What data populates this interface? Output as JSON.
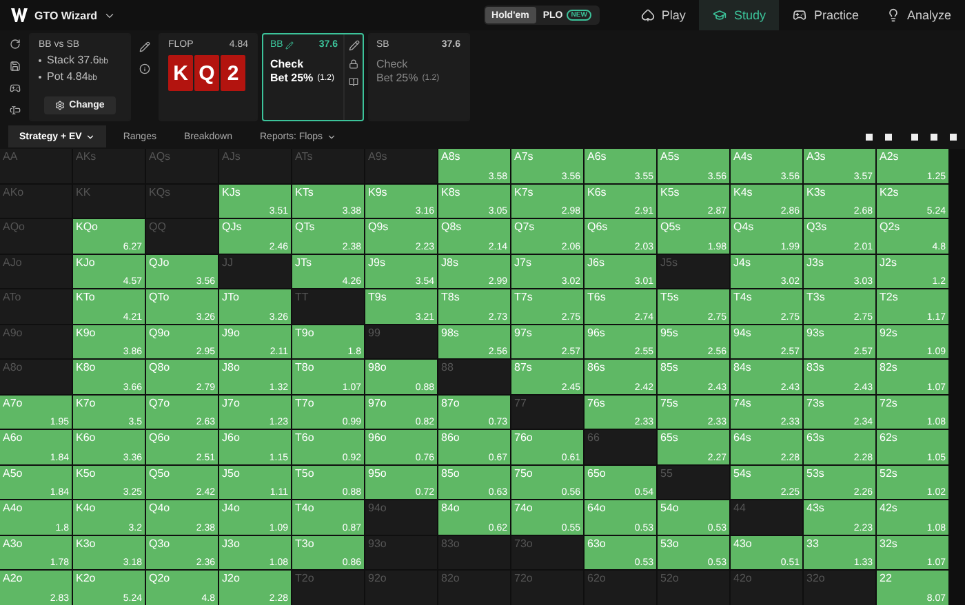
{
  "app": {
    "title": "GTO Wizard"
  },
  "game_toggle": [
    {
      "label": "Hold'em",
      "selected": true
    },
    {
      "label": "PLO",
      "selected": false,
      "badge": "NEW"
    }
  ],
  "nav": [
    {
      "label": "Play",
      "selected": false
    },
    {
      "label": "Study",
      "selected": true
    },
    {
      "label": "Practice",
      "selected": false
    },
    {
      "label": "Analyze",
      "selected": false
    }
  ],
  "scenario": {
    "title": "BB vs SB",
    "lines": [
      {
        "label": "Stack 37.6",
        "unit": "bb"
      },
      {
        "label": "Pot 4.84",
        "unit": "bb"
      }
    ],
    "button": "Change"
  },
  "flop": {
    "label": "FLOP",
    "pot": "4.84",
    "cards": [
      "K",
      "Q",
      "2"
    ]
  },
  "players": [
    {
      "name": "BB",
      "stack": "37.6",
      "selected": true,
      "actions": [
        "Check",
        "Bet 25%"
      ],
      "size": "(1.2)"
    },
    {
      "name": "SB",
      "stack": "37.6",
      "selected": false,
      "actions": [
        "Check",
        "Bet 25%"
      ],
      "size": "(1.2)"
    }
  ],
  "tabs": [
    {
      "label": "Strategy + EV",
      "selected": true,
      "dropdown": true
    },
    {
      "label": "Ranges",
      "selected": false,
      "dropdown": false
    },
    {
      "label": "Breakdown",
      "selected": false,
      "dropdown": false
    },
    {
      "label": "Reports: Flops",
      "selected": false,
      "dropdown": true
    }
  ],
  "grid": [
    [
      {
        "hand": "AA",
        "active": false
      },
      {
        "hand": "AKs",
        "active": false
      },
      {
        "hand": "AQs",
        "active": false
      },
      {
        "hand": "AJs",
        "active": false
      },
      {
        "hand": "ATs",
        "active": false
      },
      {
        "hand": "A9s",
        "active": false
      },
      {
        "hand": "A8s",
        "active": true,
        "ev": "3.58"
      },
      {
        "hand": "A7s",
        "active": true,
        "ev": "3.56"
      },
      {
        "hand": "A6s",
        "active": true,
        "ev": "3.55"
      },
      {
        "hand": "A5s",
        "active": true,
        "ev": "3.56"
      },
      {
        "hand": "A4s",
        "active": true,
        "ev": "3.56"
      },
      {
        "hand": "A3s",
        "active": true,
        "ev": "3.57"
      },
      {
        "hand": "A2s",
        "active": true,
        "ev": "1.25"
      }
    ],
    [
      {
        "hand": "AKo",
        "active": false
      },
      {
        "hand": "KK",
        "active": false
      },
      {
        "hand": "KQs",
        "active": false
      },
      {
        "hand": "KJs",
        "active": true,
        "ev": "3.51"
      },
      {
        "hand": "KTs",
        "active": true,
        "ev": "3.38"
      },
      {
        "hand": "K9s",
        "active": true,
        "ev": "3.16"
      },
      {
        "hand": "K8s",
        "active": true,
        "ev": "3.05"
      },
      {
        "hand": "K7s",
        "active": true,
        "ev": "2.98"
      },
      {
        "hand": "K6s",
        "active": true,
        "ev": "2.91"
      },
      {
        "hand": "K5s",
        "active": true,
        "ev": "2.87"
      },
      {
        "hand": "K4s",
        "active": true,
        "ev": "2.86"
      },
      {
        "hand": "K3s",
        "active": true,
        "ev": "2.68"
      },
      {
        "hand": "K2s",
        "active": true,
        "ev": "5.24"
      }
    ],
    [
      {
        "hand": "AQo",
        "active": false
      },
      {
        "hand": "KQo",
        "active": true,
        "ev": "6.27"
      },
      {
        "hand": "QQ",
        "active": false
      },
      {
        "hand": "QJs",
        "active": true,
        "ev": "2.46"
      },
      {
        "hand": "QTs",
        "active": true,
        "ev": "2.38"
      },
      {
        "hand": "Q9s",
        "active": true,
        "ev": "2.23"
      },
      {
        "hand": "Q8s",
        "active": true,
        "ev": "2.14"
      },
      {
        "hand": "Q7s",
        "active": true,
        "ev": "2.06"
      },
      {
        "hand": "Q6s",
        "active": true,
        "ev": "2.03"
      },
      {
        "hand": "Q5s",
        "active": true,
        "ev": "1.98"
      },
      {
        "hand": "Q4s",
        "active": true,
        "ev": "1.99"
      },
      {
        "hand": "Q3s",
        "active": true,
        "ev": "2.01"
      },
      {
        "hand": "Q2s",
        "active": true,
        "ev": "4.8"
      }
    ],
    [
      {
        "hand": "AJo",
        "active": false
      },
      {
        "hand": "KJo",
        "active": true,
        "ev": "4.57"
      },
      {
        "hand": "QJo",
        "active": true,
        "ev": "3.56"
      },
      {
        "hand": "JJ",
        "active": false
      },
      {
        "hand": "JTs",
        "active": true,
        "ev": "4.26"
      },
      {
        "hand": "J9s",
        "active": true,
        "ev": "3.54"
      },
      {
        "hand": "J8s",
        "active": true,
        "ev": "2.99"
      },
      {
        "hand": "J7s",
        "active": true,
        "ev": "3.02"
      },
      {
        "hand": "J6s",
        "active": true,
        "ev": "3.01"
      },
      {
        "hand": "J5s",
        "active": false
      },
      {
        "hand": "J4s",
        "active": true,
        "ev": "3.02"
      },
      {
        "hand": "J3s",
        "active": true,
        "ev": "3.03"
      },
      {
        "hand": "J2s",
        "active": true,
        "ev": "1.2"
      }
    ],
    [
      {
        "hand": "ATo",
        "active": false
      },
      {
        "hand": "KTo",
        "active": true,
        "ev": "4.21"
      },
      {
        "hand": "QTo",
        "active": true,
        "ev": "3.26"
      },
      {
        "hand": "JTo",
        "active": true,
        "ev": "3.26"
      },
      {
        "hand": "TT",
        "active": false
      },
      {
        "hand": "T9s",
        "active": true,
        "ev": "3.21"
      },
      {
        "hand": "T8s",
        "active": true,
        "ev": "2.73"
      },
      {
        "hand": "T7s",
        "active": true,
        "ev": "2.75"
      },
      {
        "hand": "T6s",
        "active": true,
        "ev": "2.74"
      },
      {
        "hand": "T5s",
        "active": true,
        "ev": "2.75"
      },
      {
        "hand": "T4s",
        "active": true,
        "ev": "2.75"
      },
      {
        "hand": "T3s",
        "active": true,
        "ev": "2.75"
      },
      {
        "hand": "T2s",
        "active": true,
        "ev": "1.17"
      }
    ],
    [
      {
        "hand": "A9o",
        "active": false
      },
      {
        "hand": "K9o",
        "active": true,
        "ev": "3.86"
      },
      {
        "hand": "Q9o",
        "active": true,
        "ev": "2.95"
      },
      {
        "hand": "J9o",
        "active": true,
        "ev": "2.11"
      },
      {
        "hand": "T9o",
        "active": true,
        "ev": "1.8"
      },
      {
        "hand": "99",
        "active": false
      },
      {
        "hand": "98s",
        "active": true,
        "ev": "2.56"
      },
      {
        "hand": "97s",
        "active": true,
        "ev": "2.57"
      },
      {
        "hand": "96s",
        "active": true,
        "ev": "2.55"
      },
      {
        "hand": "95s",
        "active": true,
        "ev": "2.56"
      },
      {
        "hand": "94s",
        "active": true,
        "ev": "2.57"
      },
      {
        "hand": "93s",
        "active": true,
        "ev": "2.57"
      },
      {
        "hand": "92s",
        "active": true,
        "ev": "1.09"
      }
    ],
    [
      {
        "hand": "A8o",
        "active": false
      },
      {
        "hand": "K8o",
        "active": true,
        "ev": "3.66"
      },
      {
        "hand": "Q8o",
        "active": true,
        "ev": "2.79"
      },
      {
        "hand": "J8o",
        "active": true,
        "ev": "1.32"
      },
      {
        "hand": "T8o",
        "active": true,
        "ev": "1.07"
      },
      {
        "hand": "98o",
        "active": true,
        "ev": "0.88"
      },
      {
        "hand": "88",
        "active": false
      },
      {
        "hand": "87s",
        "active": true,
        "ev": "2.45"
      },
      {
        "hand": "86s",
        "active": true,
        "ev": "2.42"
      },
      {
        "hand": "85s",
        "active": true,
        "ev": "2.43"
      },
      {
        "hand": "84s",
        "active": true,
        "ev": "2.43"
      },
      {
        "hand": "83s",
        "active": true,
        "ev": "2.43"
      },
      {
        "hand": "82s",
        "active": true,
        "ev": "1.07"
      }
    ],
    [
      {
        "hand": "A7o",
        "active": true,
        "ev": "1.95"
      },
      {
        "hand": "K7o",
        "active": true,
        "ev": "3.5"
      },
      {
        "hand": "Q7o",
        "active": true,
        "ev": "2.63"
      },
      {
        "hand": "J7o",
        "active": true,
        "ev": "1.23"
      },
      {
        "hand": "T7o",
        "active": true,
        "ev": "0.99"
      },
      {
        "hand": "97o",
        "active": true,
        "ev": "0.82"
      },
      {
        "hand": "87o",
        "active": true,
        "ev": "0.73"
      },
      {
        "hand": "77",
        "active": false
      },
      {
        "hand": "76s",
        "active": true,
        "ev": "2.33"
      },
      {
        "hand": "75s",
        "active": true,
        "ev": "2.33"
      },
      {
        "hand": "74s",
        "active": true,
        "ev": "2.33"
      },
      {
        "hand": "73s",
        "active": true,
        "ev": "2.34"
      },
      {
        "hand": "72s",
        "active": true,
        "ev": "1.08"
      }
    ],
    [
      {
        "hand": "A6o",
        "active": true,
        "ev": "1.84"
      },
      {
        "hand": "K6o",
        "active": true,
        "ev": "3.36"
      },
      {
        "hand": "Q6o",
        "active": true,
        "ev": "2.51"
      },
      {
        "hand": "J6o",
        "active": true,
        "ev": "1.15"
      },
      {
        "hand": "T6o",
        "active": true,
        "ev": "0.92"
      },
      {
        "hand": "96o",
        "active": true,
        "ev": "0.76"
      },
      {
        "hand": "86o",
        "active": true,
        "ev": "0.67"
      },
      {
        "hand": "76o",
        "active": true,
        "ev": "0.61"
      },
      {
        "hand": "66",
        "active": false
      },
      {
        "hand": "65s",
        "active": true,
        "ev": "2.27"
      },
      {
        "hand": "64s",
        "active": true,
        "ev": "2.28"
      },
      {
        "hand": "63s",
        "active": true,
        "ev": "2.28"
      },
      {
        "hand": "62s",
        "active": true,
        "ev": "1.05"
      }
    ],
    [
      {
        "hand": "A5o",
        "active": true,
        "ev": "1.84"
      },
      {
        "hand": "K5o",
        "active": true,
        "ev": "3.25"
      },
      {
        "hand": "Q5o",
        "active": true,
        "ev": "2.42"
      },
      {
        "hand": "J5o",
        "active": true,
        "ev": "1.11"
      },
      {
        "hand": "T5o",
        "active": true,
        "ev": "0.88"
      },
      {
        "hand": "95o",
        "active": true,
        "ev": "0.72"
      },
      {
        "hand": "85o",
        "active": true,
        "ev": "0.63"
      },
      {
        "hand": "75o",
        "active": true,
        "ev": "0.56"
      },
      {
        "hand": "65o",
        "active": true,
        "ev": "0.54"
      },
      {
        "hand": "55",
        "active": false
      },
      {
        "hand": "54s",
        "active": true,
        "ev": "2.25"
      },
      {
        "hand": "53s",
        "active": true,
        "ev": "2.26"
      },
      {
        "hand": "52s",
        "active": true,
        "ev": "1.02"
      }
    ],
    [
      {
        "hand": "A4o",
        "active": true,
        "ev": "1.8"
      },
      {
        "hand": "K4o",
        "active": true,
        "ev": "3.2"
      },
      {
        "hand": "Q4o",
        "active": true,
        "ev": "2.38"
      },
      {
        "hand": "J4o",
        "active": true,
        "ev": "1.09"
      },
      {
        "hand": "T4o",
        "active": true,
        "ev": "0.87"
      },
      {
        "hand": "94o",
        "active": false
      },
      {
        "hand": "84o",
        "active": true,
        "ev": "0.62"
      },
      {
        "hand": "74o",
        "active": true,
        "ev": "0.55"
      },
      {
        "hand": "64o",
        "active": true,
        "ev": "0.53"
      },
      {
        "hand": "54o",
        "active": true,
        "ev": "0.53"
      },
      {
        "hand": "44",
        "active": false
      },
      {
        "hand": "43s",
        "active": true,
        "ev": "2.23"
      },
      {
        "hand": "42s",
        "active": true,
        "ev": "1.08"
      }
    ],
    [
      {
        "hand": "A3o",
        "active": true,
        "ev": "1.78"
      },
      {
        "hand": "K3o",
        "active": true,
        "ev": "3.18"
      },
      {
        "hand": "Q3o",
        "active": true,
        "ev": "2.36"
      },
      {
        "hand": "J3o",
        "active": true,
        "ev": "1.08"
      },
      {
        "hand": "T3o",
        "active": true,
        "ev": "0.86"
      },
      {
        "hand": "93o",
        "active": false
      },
      {
        "hand": "83o",
        "active": false
      },
      {
        "hand": "73o",
        "active": false
      },
      {
        "hand": "63o",
        "active": true,
        "ev": "0.53"
      },
      {
        "hand": "53o",
        "active": true,
        "ev": "0.53"
      },
      {
        "hand": "43o",
        "active": true,
        "ev": "0.51"
      },
      {
        "hand": "33",
        "active": true,
        "ev": "1.33"
      },
      {
        "hand": "32s",
        "active": true,
        "ev": "1.07"
      }
    ],
    [
      {
        "hand": "A2o",
        "active": true,
        "ev": "2.83"
      },
      {
        "hand": "K2o",
        "active": true,
        "ev": "5.24"
      },
      {
        "hand": "Q2o",
        "active": true,
        "ev": "4.8"
      },
      {
        "hand": "J2o",
        "active": true,
        "ev": "2.28"
      },
      {
        "hand": "T2o",
        "active": false
      },
      {
        "hand": "92o",
        "active": false
      },
      {
        "hand": "82o",
        "active": false
      },
      {
        "hand": "72o",
        "active": false
      },
      {
        "hand": "62o",
        "active": false
      },
      {
        "hand": "52o",
        "active": false
      },
      {
        "hand": "42o",
        "active": false
      },
      {
        "hand": "32o",
        "active": false
      },
      {
        "hand": "22",
        "active": true,
        "ev": "8.07"
      }
    ]
  ]
}
